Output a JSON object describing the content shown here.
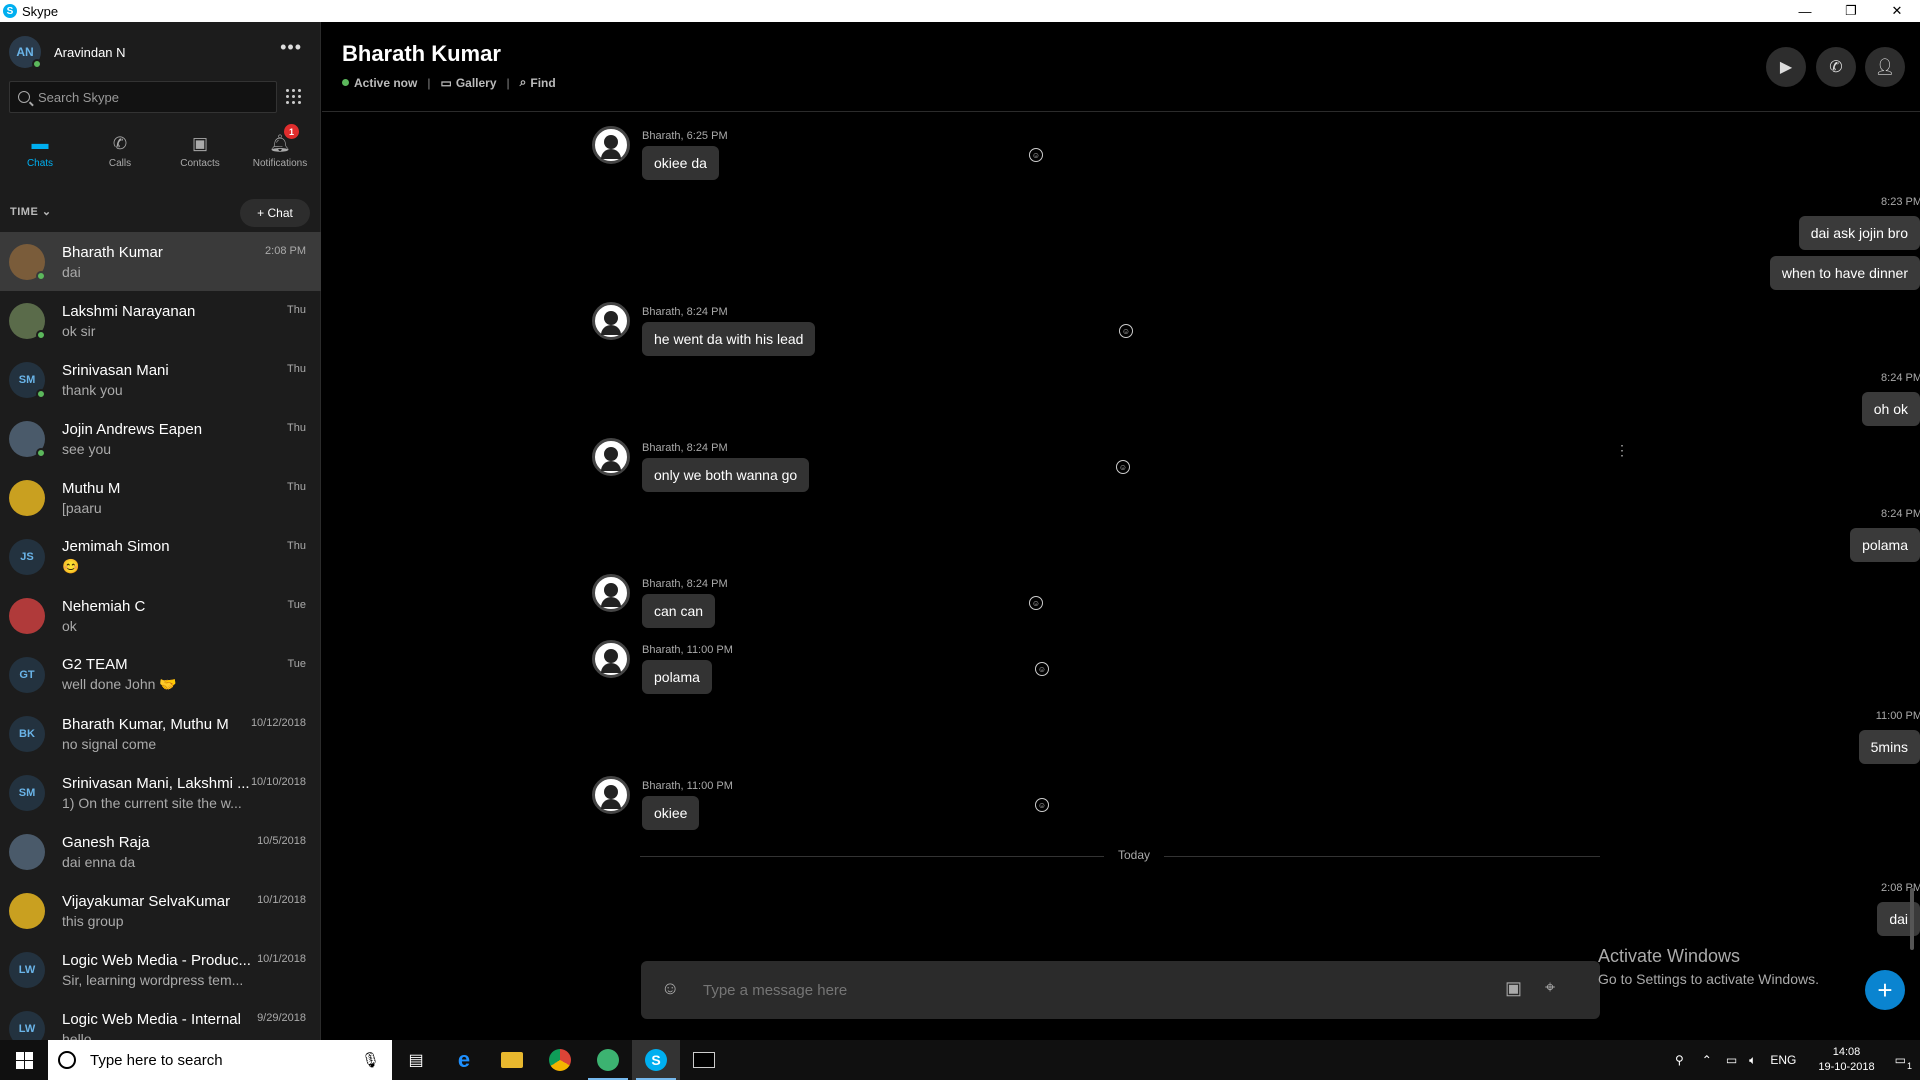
{
  "window": {
    "title": "Skype",
    "minimize": "—",
    "restore": "❐",
    "close": "✕"
  },
  "me": {
    "initials": "AN",
    "name": "Aravindan N",
    "more": "•••"
  },
  "search": {
    "placeholder": "Search Skype"
  },
  "nav": [
    {
      "label": "Chats",
      "icon": "chat-icon"
    },
    {
      "label": "Calls",
      "icon": "phone-icon"
    },
    {
      "label": "Contacts",
      "icon": "contacts-icon"
    },
    {
      "label": "Notifications",
      "icon": "bell-icon",
      "badge": "1"
    }
  ],
  "sort_label": "TIME",
  "new_chat": "+ Chat",
  "chats": [
    {
      "name": "Bharath Kumar",
      "preview": "dai",
      "time": "2:08 PM",
      "initials": "",
      "online": true,
      "selected": true,
      "avatar": "photo"
    },
    {
      "name": "Lakshmi Narayanan",
      "preview": "ok sir",
      "time": "Thu",
      "initials": "",
      "online": true,
      "avatar": "photo"
    },
    {
      "name": "Srinivasan Mani",
      "preview": "thank you",
      "time": "Thu",
      "initials": "SM",
      "online": true
    },
    {
      "name": "Jojin Andrews Eapen",
      "preview": "see you",
      "time": "Thu",
      "initials": "",
      "online": true,
      "avatar": "photo"
    },
    {
      "name": "Muthu M",
      "preview": "[paaru",
      "time": "Thu",
      "initials": "",
      "avatar": "photo"
    },
    {
      "name": "Jemimah Simon",
      "preview": "😊",
      "time": "Thu",
      "initials": "JS"
    },
    {
      "name": "Nehemiah C",
      "preview": "ok",
      "time": "Tue",
      "initials": "",
      "avatar": "photo"
    },
    {
      "name": "G2 TEAM",
      "preview": "well done John 🤝",
      "time": "Tue",
      "initials": "GT"
    },
    {
      "name": "Bharath Kumar, Muthu M",
      "preview": "no signal come",
      "time": "10/12/2018",
      "initials": "BK"
    },
    {
      "name": "Srinivasan Mani, Lakshmi ...",
      "preview": "1) On the current site the w...",
      "time": "10/10/2018",
      "initials": "SM"
    },
    {
      "name": "Ganesh Raja",
      "preview": "dai enna da",
      "time": "10/5/2018",
      "initials": "",
      "avatar": "photo"
    },
    {
      "name": "Vijayakumar SelvaKumar",
      "preview": "this group",
      "time": "10/1/2018",
      "initials": "",
      "avatar": "photo"
    },
    {
      "name": "Logic Web Media - Produc...",
      "preview": "Sir, learning wordpress tem...",
      "time": "10/1/2018",
      "initials": "LW"
    },
    {
      "name": "Logic Web Media - Internal",
      "preview": "hello",
      "time": "9/29/2018",
      "initials": "LW"
    }
  ],
  "header": {
    "title": "Bharath Kumar",
    "status": "Active now",
    "gallery": "Gallery",
    "find": "Find"
  },
  "messages": {
    "m1_ts": "Bharath, 6:25 PM",
    "m1": "okiee da",
    "m2_ts": "8:23 PM",
    "m2a": "dai ask jojin bro",
    "m2b": "when to have dinner",
    "m3_ts": "Bharath, 8:24 PM",
    "m3": "he went da with his lead",
    "m4_ts": "8:24 PM",
    "m4": "oh ok",
    "m5_ts": "Bharath, 8:24 PM",
    "m5": "only we both wanna go",
    "m6_ts": "8:24 PM",
    "m6": "polama",
    "m7_ts": "Bharath, 8:24 PM",
    "m7": "can can",
    "m8_ts": "Bharath, 11:00 PM",
    "m8": "polama",
    "m9_ts": "11:00 PM",
    "m9": "5mins",
    "m10_ts": "Bharath, 11:00 PM",
    "m10": "okiee",
    "divider": "Today",
    "m11_ts": "2:08 PM",
    "m11": "dai"
  },
  "composer": {
    "placeholder": "Type a message here"
  },
  "watermark": {
    "line1": "Activate Windows",
    "line2": "Go to Settings to activate Windows."
  },
  "taskbar": {
    "search_placeholder": "Type here to search",
    "lang": "ENG",
    "time": "14:08",
    "date": "19-10-2018",
    "notif_count": "1"
  },
  "colors": {
    "accent": "#00aff0",
    "online": "#5cb85c",
    "badge": "#e02d2d"
  }
}
